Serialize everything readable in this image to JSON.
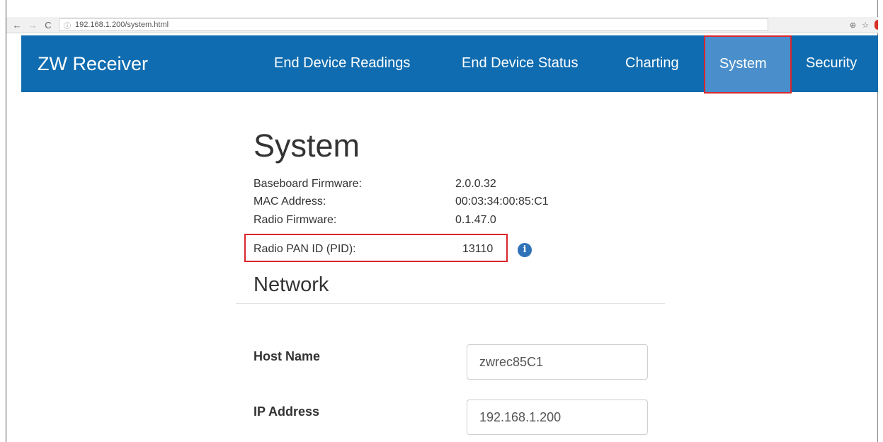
{
  "browser": {
    "url": "192.168.1.200/system.html",
    "back_icon": "←",
    "forward_icon": "→",
    "reload_icon": "C",
    "info_icon": "ⓘ",
    "zoom_icon": "⊕",
    "star_icon": "☆"
  },
  "navbar": {
    "brand": "ZW Receiver",
    "items": [
      {
        "label": "End Device Readings"
      },
      {
        "label": "End Device Status"
      },
      {
        "label": "Charting"
      },
      {
        "label": "System",
        "active": true
      },
      {
        "label": "Security"
      }
    ],
    "color": "#0f6cb0",
    "active_color": "#4a8fcb",
    "highlight_color": "#d9262d"
  },
  "page": {
    "title": "System",
    "info": [
      {
        "label": "Baseboard Firmware:",
        "value": "2.0.0.32"
      },
      {
        "label": "MAC Address:",
        "value": "00:03:34:00:85:C1"
      },
      {
        "label": "Radio Firmware:",
        "value": "0.1.47.0"
      },
      {
        "label": "Radio PAN ID (PID):",
        "value": "13110"
      }
    ],
    "pid_info_icon": "i",
    "network": {
      "title": "Network",
      "fields": [
        {
          "label": "Host Name",
          "value": "zwrec85C1"
        },
        {
          "label": "IP Address",
          "value": "192.168.1.200"
        }
      ]
    }
  }
}
